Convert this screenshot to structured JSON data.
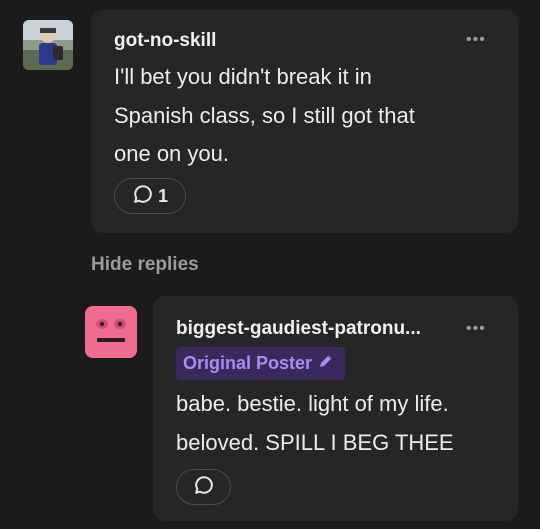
{
  "comment1": {
    "username": "got-no-skill",
    "text_lines": [
      "I'll bet you didn't break it in",
      "Spanish class, so I still got that",
      "one on you."
    ],
    "reply_count": "1",
    "more_icon": "ellipsis-icon"
  },
  "hide_replies": "Hide replies",
  "comment2": {
    "username": "biggest-gaudiest-patronu...",
    "badge": "Original Poster",
    "text_lines": [
      "babe. bestie. light of my life.",
      "beloved. SPILL I BEG THEE"
    ],
    "more_icon": "ellipsis-icon"
  },
  "colors": {
    "background": "#1b1b1b",
    "card": "#262626",
    "badge_bg": "#3a2a5c",
    "badge_text": "#a98cf3",
    "avatar2": "#ef6b8f"
  }
}
